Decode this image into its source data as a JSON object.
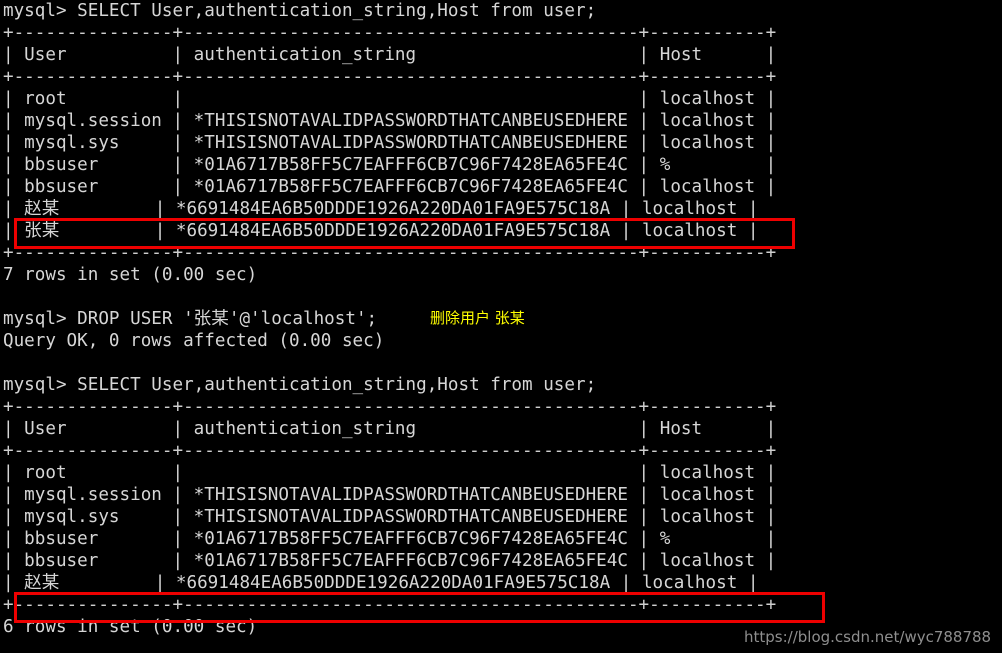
{
  "terminal": {
    "prompt": "mysql>",
    "colors": {
      "background": "#000000",
      "foreground": "#d6d6d6",
      "annotation": "#ffff00",
      "highlight_box": "#ee0000",
      "watermark": "#8e8e8e"
    },
    "lines": [
      {
        "id": "l0",
        "text": "mysql> SELECT User,authentication_string,Host from user;"
      },
      {
        "id": "l1",
        "text": "+---------------+-------------------------------------------+-----------+"
      },
      {
        "id": "l2",
        "text": "| User          | authentication_string                     | Host      |"
      },
      {
        "id": "l3",
        "text": "+---------------+-------------------------------------------+-----------+"
      },
      {
        "id": "l4",
        "text": "| root          |                                           | localhost |"
      },
      {
        "id": "l5",
        "text": "| mysql.session | *THISISNOTAVALIDPASSWORDTHATCANBEUSEDHERE | localhost |"
      },
      {
        "id": "l6",
        "text": "| mysql.sys     | *THISISNOTAVALIDPASSWORDTHATCANBEUSEDHERE | localhost |"
      },
      {
        "id": "l7",
        "text": "| bbsuser       | *01A6717B58FF5C7EAFFF6CB7C96F7428EA65FE4C | %         |"
      },
      {
        "id": "l8",
        "text": "| bbsuser       | *01A6717B58FF5C7EAFFF6CB7C96F7428EA65FE4C | localhost |"
      },
      {
        "id": "l9",
        "text": "| 赵某         | *6691484EA6B50DDDE1926A220DA01FA9E575C18A | localhost |"
      },
      {
        "id": "l10",
        "text": "| 张某         | *6691484EA6B50DDDE1926A220DA01FA9E575C18A | localhost |"
      },
      {
        "id": "l11",
        "text": "+---------------+-------------------------------------------+-----------+"
      },
      {
        "id": "l12",
        "text": "7 rows in set (0.00 sec)"
      },
      {
        "id": "l13",
        "text": ""
      },
      {
        "id": "l14",
        "text": "mysql> DROP USER '张某'@'localhost';"
      },
      {
        "id": "l15",
        "text": "Query OK, 0 rows affected (0.00 sec)"
      },
      {
        "id": "l16",
        "text": ""
      },
      {
        "id": "l17",
        "text": "mysql> SELECT User,authentication_string,Host from user;"
      },
      {
        "id": "l18",
        "text": "+---------------+-------------------------------------------+-----------+"
      },
      {
        "id": "l19",
        "text": "| User          | authentication_string                     | Host      |"
      },
      {
        "id": "l20",
        "text": "+---------------+-------------------------------------------+-----------+"
      },
      {
        "id": "l21",
        "text": "| root          |                                           | localhost |"
      },
      {
        "id": "l22",
        "text": "| mysql.session | *THISISNOTAVALIDPASSWORDTHATCANBEUSEDHERE | localhost |"
      },
      {
        "id": "l23",
        "text": "| mysql.sys     | *THISISNOTAVALIDPASSWORDTHATCANBEUSEDHERE | localhost |"
      },
      {
        "id": "l24",
        "text": "| bbsuser       | *01A6717B58FF5C7EAFFF6CB7C96F7428EA65FE4C | %         |"
      },
      {
        "id": "l25",
        "text": "| bbsuser       | *01A6717B58FF5C7EAFFF6CB7C96F7428EA65FE4C | localhost |"
      },
      {
        "id": "l26",
        "text": "| 赵某         | *6691484EA6B50DDDE1926A220DA01FA9E575C18A | localhost |"
      },
      {
        "id": "l27",
        "text": "+---------------+-------------------------------------------+-----------+"
      },
      {
        "id": "l28",
        "text": "6 rows in set (0.00 sec)"
      }
    ],
    "annotations": [
      {
        "id": "a0",
        "text": "删除用户 张某"
      }
    ],
    "watermark": "https://blog.csdn.net/wyc788788"
  },
  "queries": {
    "first_select": {
      "command": "SELECT User,authentication_string,Host from user;",
      "columns": [
        "User",
        "authentication_string",
        "Host"
      ],
      "rows": [
        {
          "User": "root",
          "authentication_string": "",
          "Host": "localhost"
        },
        {
          "User": "mysql.session",
          "authentication_string": "*THISISNOTAVALIDPASSWORDTHATCANBEUSEDHERE",
          "Host": "localhost"
        },
        {
          "User": "mysql.sys",
          "authentication_string": "*THISISNOTAVALIDPASSWORDTHATCANBEUSEDHERE",
          "Host": "localhost"
        },
        {
          "User": "bbsuser",
          "authentication_string": "*01A6717B58FF5C7EAFFF6CB7C96F7428EA65FE4C",
          "Host": "%"
        },
        {
          "User": "bbsuser",
          "authentication_string": "*01A6717B58FF5C7EAFFF6CB7C96F7428EA65FE4C",
          "Host": "localhost"
        },
        {
          "User": "赵某",
          "authentication_string": "*6691484EA6B50DDDE1926A220DA01FA9E575C18A",
          "Host": "localhost"
        },
        {
          "User": "张某",
          "authentication_string": "*6691484EA6B50DDDE1926A220DA01FA9E575C18A",
          "Host": "localhost"
        }
      ],
      "result_text": "7 rows in set (0.00 sec)"
    },
    "drop_user": {
      "command": "DROP USER '张某'@'localhost';",
      "annotation": "删除用户 张某",
      "result_text": "Query OK, 0 rows affected (0.00 sec)"
    },
    "second_select": {
      "command": "SELECT User,authentication_string,Host from user;",
      "columns": [
        "User",
        "authentication_string",
        "Host"
      ],
      "rows": [
        {
          "User": "root",
          "authentication_string": "",
          "Host": "localhost"
        },
        {
          "User": "mysql.session",
          "authentication_string": "*THISISNOTAVALIDPASSWORDTHATCANBEUSEDHERE",
          "Host": "localhost"
        },
        {
          "User": "mysql.sys",
          "authentication_string": "*THISISNOTAVALIDPASSWORDTHATCANBEUSEDHERE",
          "Host": "localhost"
        },
        {
          "User": "bbsuser",
          "authentication_string": "*01A6717B58FF5C7EAFFF6CB7C96F7428EA65FE4C",
          "Host": "%"
        },
        {
          "User": "bbsuser",
          "authentication_string": "*01A6717B58FF5C7EAFFF6CB7C96F7428EA65FE4C",
          "Host": "localhost"
        },
        {
          "User": "赵某",
          "authentication_string": "*6691484EA6B50DDDE1926A220DA01FA9E575C18A",
          "Host": "localhost"
        }
      ],
      "result_text": "6 rows in set (0.00 sec)"
    }
  }
}
